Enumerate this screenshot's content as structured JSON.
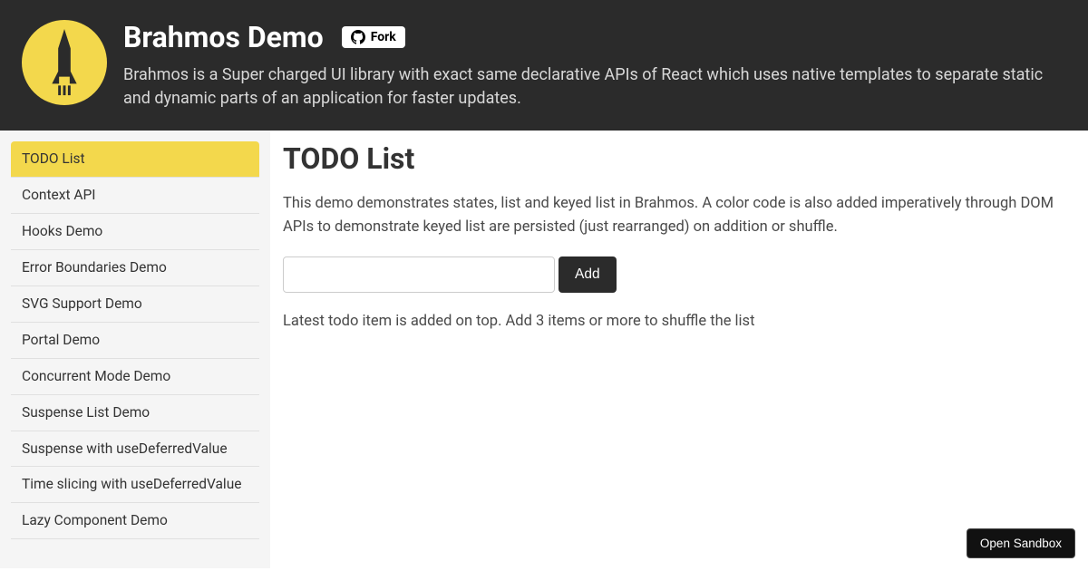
{
  "header": {
    "title": "Brahmos Demo",
    "fork_label": "Fork",
    "description": "Brahmos is a Super charged UI library with exact same declarative APIs of React which uses native templates to separate static and dynamic parts of an application for faster updates."
  },
  "sidebar": {
    "items": [
      {
        "label": "TODO List",
        "active": true
      },
      {
        "label": "Context API",
        "active": false
      },
      {
        "label": "Hooks Demo",
        "active": false
      },
      {
        "label": "Error Boundaries Demo",
        "active": false
      },
      {
        "label": "SVG Support Demo",
        "active": false
      },
      {
        "label": "Portal Demo",
        "active": false
      },
      {
        "label": "Concurrent Mode Demo",
        "active": false
      },
      {
        "label": "Suspense List Demo",
        "active": false
      },
      {
        "label": "Suspense with useDeferredValue",
        "active": false
      },
      {
        "label": "Time slicing with useDeferredValue",
        "active": false
      },
      {
        "label": "Lazy Component Demo",
        "active": false
      }
    ]
  },
  "main": {
    "title": "TODO List",
    "description": "This demo demonstrates states, list and keyed list in Brahmos. A color code is also added imperatively through DOM APIs to demonstrate keyed list are persisted (just rearranged) on addition or shuffle.",
    "input_value": "",
    "add_label": "Add",
    "hint": "Latest todo item is added on top. Add 3 items or more to shuffle the list"
  },
  "sandbox": {
    "open_label": "Open Sandbox"
  }
}
